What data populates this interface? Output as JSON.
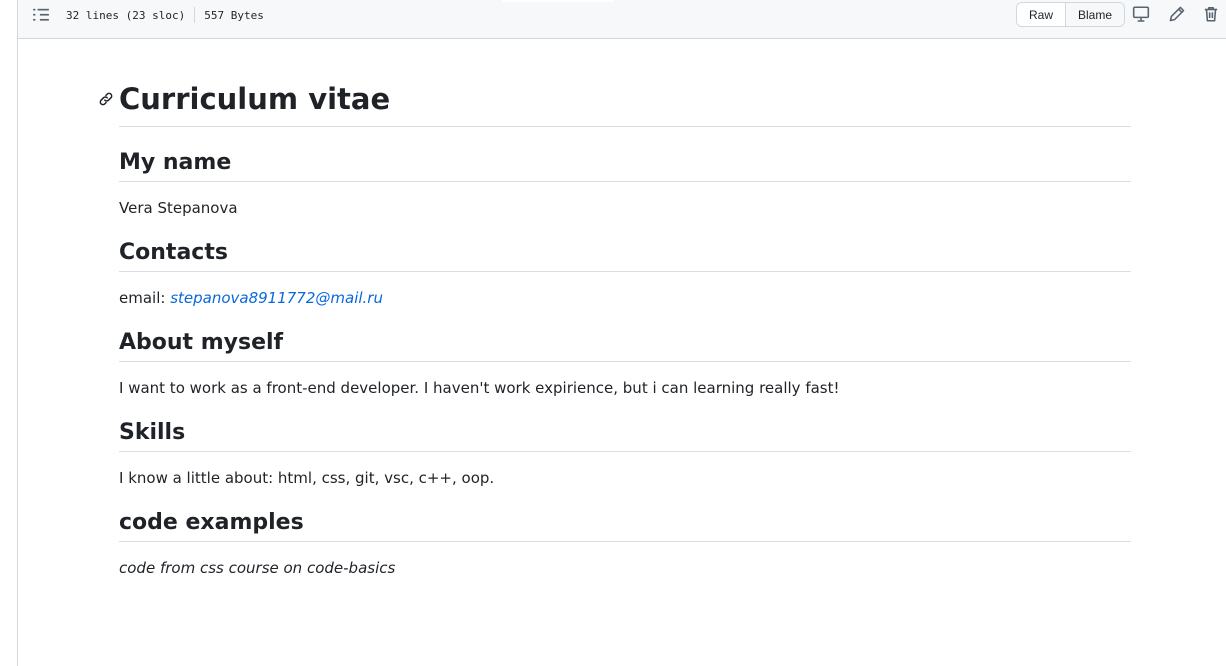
{
  "file_header": {
    "lines": "32 lines (23 sloc)",
    "size": "557 Bytes",
    "raw_label": "Raw",
    "blame_label": "Blame",
    "icons": [
      "outline-list-icon",
      "desktop-icon",
      "pencil-icon",
      "trash-icon"
    ]
  },
  "readme": {
    "title": "Curriculum vitae",
    "sections": [
      {
        "heading": "My name",
        "text": "Vera Stepanova"
      },
      {
        "heading": "Contacts",
        "label": "email: ",
        "link": "stepanova8911772@mail.ru"
      },
      {
        "heading": "About myself",
        "text": "I want to work as a front-end developer. I haven't work expirience, but i can learning really fast!"
      },
      {
        "heading": "Skills",
        "text": "I know a little about: html, css, git, vsc, c++, oop."
      },
      {
        "heading": "code examples",
        "text": "code from css course on code-basics"
      }
    ]
  },
  "colors": {
    "link": "#0969da",
    "text": "#1f2328",
    "border": "#d0d7de",
    "header_bg": "#f6f8fa"
  }
}
